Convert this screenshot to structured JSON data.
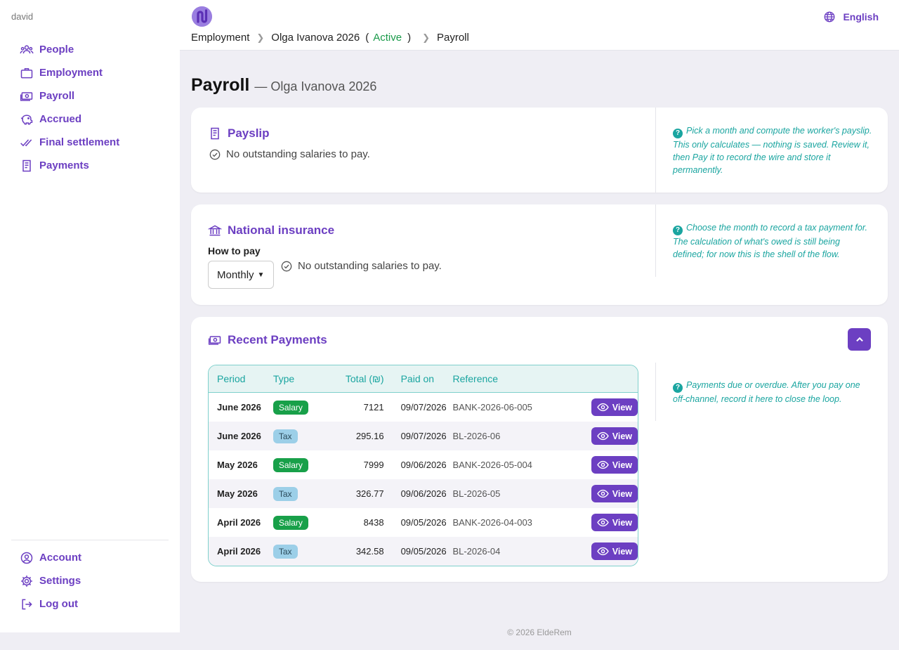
{
  "sidebar": {
    "user": "david",
    "items": [
      {
        "label": "People",
        "icon": "people-icon"
      },
      {
        "label": "Employment",
        "icon": "briefcase-icon"
      },
      {
        "label": "Payroll",
        "icon": "money-icon"
      },
      {
        "label": "Accrued",
        "icon": "piggy-bank-icon"
      },
      {
        "label": "Final settlement",
        "icon": "double-check-icon"
      },
      {
        "label": "Payments",
        "icon": "receipt-icon"
      }
    ],
    "bottom": [
      {
        "label": "Account",
        "icon": "user-circle-icon"
      },
      {
        "label": "Settings",
        "icon": "gear-icon"
      },
      {
        "label": "Log out",
        "icon": "logout-icon"
      }
    ]
  },
  "header": {
    "language": "English",
    "breadcrumb": {
      "employment": "Employment",
      "contract": "Olga Ivanova 2026",
      "open_paren": "(",
      "status": "Active",
      "close_paren": ")",
      "current": "Payroll"
    }
  },
  "page": {
    "title": "Payroll",
    "subtitle": "— Olga Ivanova 2026"
  },
  "payslip": {
    "title": "Payslip",
    "status": "No outstanding salaries to pay.",
    "help": "Pick a month and compute the worker's payslip. This only calculates — nothing is saved. Review it, then Pay it to record the wire and store it permanently."
  },
  "national_insurance": {
    "title": "National insurance",
    "how_label": "How to pay",
    "frequency": "Monthly",
    "status": "No outstanding salaries to pay.",
    "help": "Choose the month to record a tax payment for. The calculation of what's owed is still being defined; for now this is the shell of the flow."
  },
  "recent_payments": {
    "title": "Recent Payments",
    "help": "Payments due or overdue. After you pay one off-channel, record it here to close the loop.",
    "view_label": "View",
    "headers": {
      "period": "Period",
      "type": "Type",
      "total": "Total (₪)",
      "paid_on": "Paid on",
      "reference": "Reference"
    },
    "rows": [
      {
        "period": "June 2026",
        "type": "Salary",
        "total": "7121",
        "paid_on": "09/07/2026",
        "reference": "BANK-2026-06-005"
      },
      {
        "period": "June 2026",
        "type": "Tax",
        "total": "295.16",
        "paid_on": "09/07/2026",
        "reference": "BL-2026-06"
      },
      {
        "period": "May 2026",
        "type": "Salary",
        "total": "7999",
        "paid_on": "09/06/2026",
        "reference": "BANK-2026-05-004"
      },
      {
        "period": "May 2026",
        "type": "Tax",
        "total": "326.77",
        "paid_on": "09/06/2026",
        "reference": "BL-2026-05"
      },
      {
        "period": "April 2026",
        "type": "Salary",
        "total": "8438",
        "paid_on": "09/05/2026",
        "reference": "BANK-2026-04-003"
      },
      {
        "period": "April 2026",
        "type": "Tax",
        "total": "342.58",
        "paid_on": "09/05/2026",
        "reference": "BL-2026-04"
      }
    ]
  },
  "footer": "© 2026 EldeRem",
  "colors": {
    "accent": "#6c3fc2",
    "teal": "#1aa5a0",
    "success": "#18a049",
    "tax_badge": "#9ccfe8"
  }
}
